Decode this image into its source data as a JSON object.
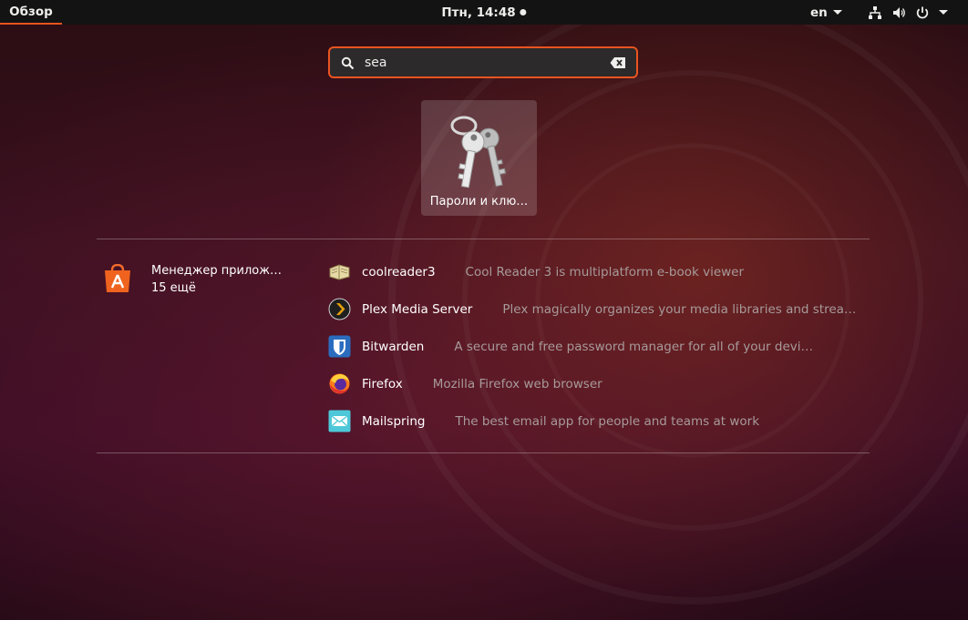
{
  "topbar": {
    "activities": "Обзор",
    "clock": "Птн, 14:48",
    "language": "en"
  },
  "search": {
    "value": "sea",
    "placeholder": ""
  },
  "app_result": {
    "label": "Пароли и клю…",
    "icon": "keys-icon"
  },
  "provider": {
    "name": "Менеджер прилож…",
    "count": "15 ещё",
    "icon": "software-store-icon"
  },
  "results": [
    {
      "name": "coolreader3",
      "description": "Cool Reader 3 is multiplatform e-book viewer",
      "icon": "book-icon"
    },
    {
      "name": "Plex Media Server",
      "description": "Plex magically organizes your media libraries and stream…",
      "icon": "plex-icon"
    },
    {
      "name": "Bitwarden",
      "description": "A secure and free password manager for all of your devices.",
      "icon": "shield-icon"
    },
    {
      "name": "Firefox",
      "description": "Mozilla Firefox web browser",
      "icon": "firefox-icon"
    },
    {
      "name": "Mailspring",
      "description": "The best email app for people and teams at work",
      "icon": "mail-icon"
    }
  ],
  "colors": {
    "accent": "#e95420",
    "topbar": "#131313"
  }
}
